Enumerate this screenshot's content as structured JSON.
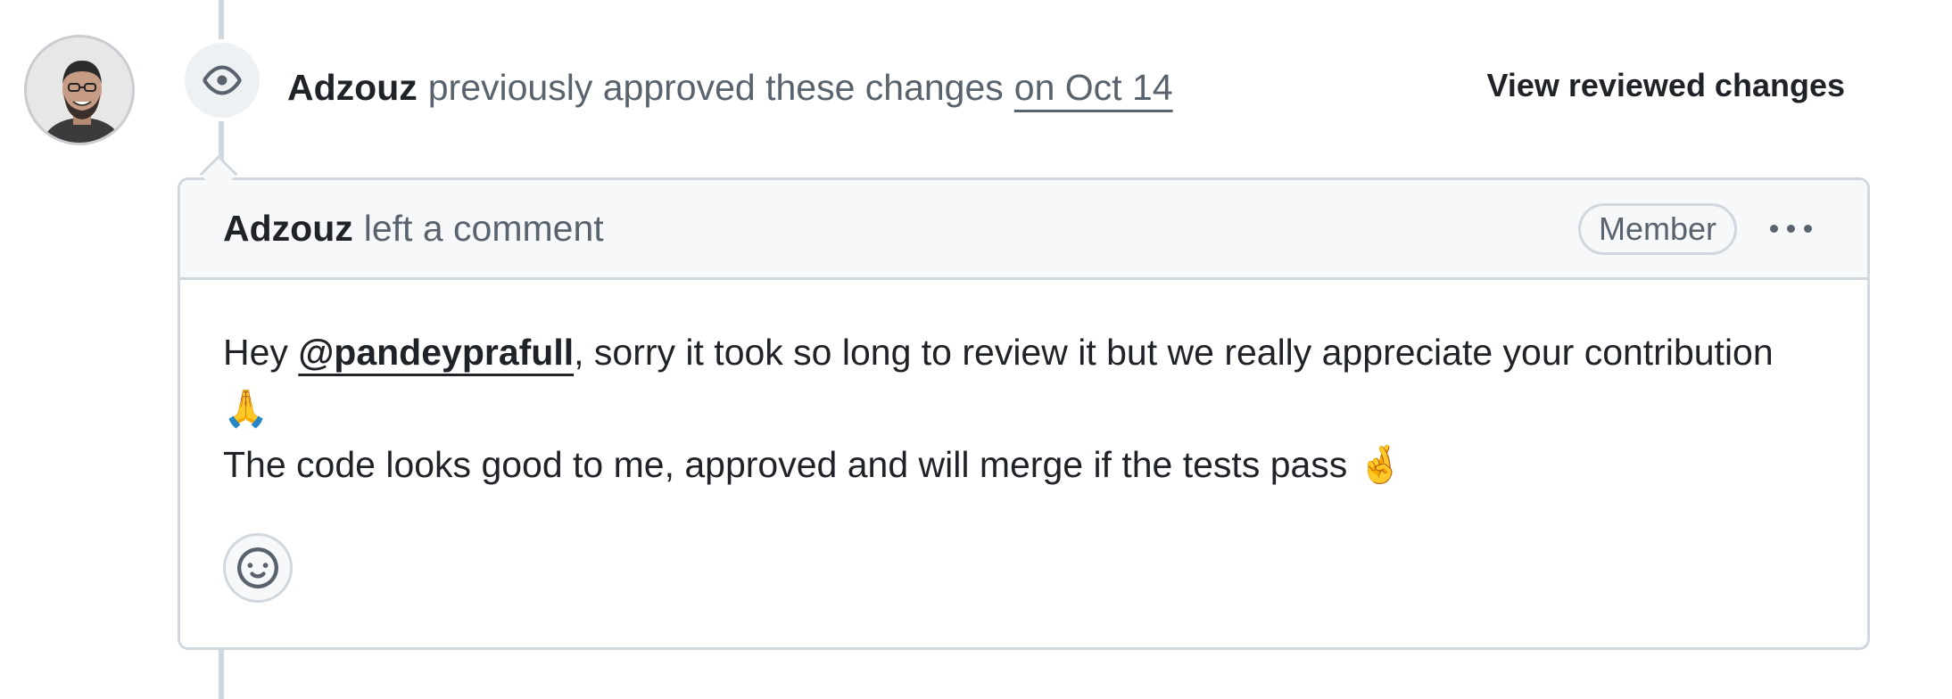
{
  "event": {
    "author": "Adzouz",
    "action": "previously approved these changes",
    "date": "on Oct 14",
    "view_link": "View reviewed changes",
    "icon": "eye-icon"
  },
  "comment": {
    "author": "Adzouz",
    "action": "left a comment",
    "role_badge": "Member",
    "body": {
      "greeting": "Hey ",
      "mention": "@pandeyprafull",
      "line1_rest": ", sorry it took so long to review it but we really appreciate your contribution ",
      "emoji1": "🙏",
      "line2": "The code looks good to me, approved and will merge if the tests pass ",
      "emoji2": "🤞"
    },
    "reaction_icon": "smiley-icon",
    "more_icon": "kebab-horizontal-icon"
  },
  "colors": {
    "border": "#d0d7de",
    "muted_text": "#59636e",
    "header_bg": "#f6f8fa",
    "text": "#1f2328"
  }
}
